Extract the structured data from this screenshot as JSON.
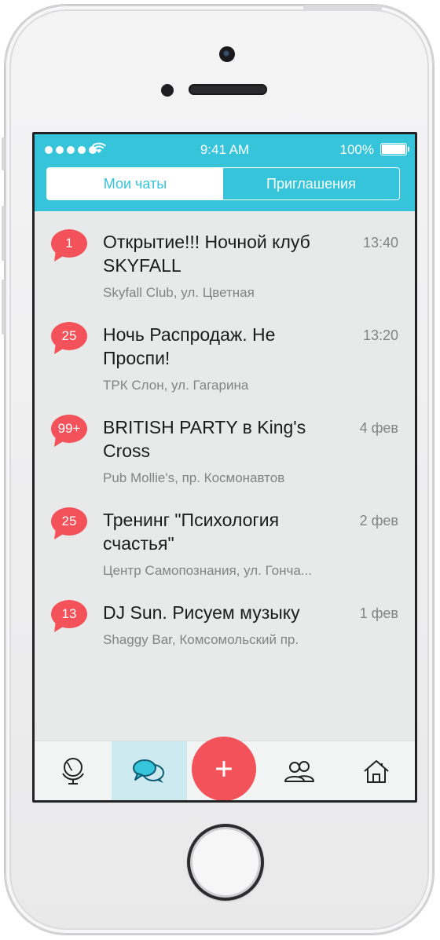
{
  "status_bar": {
    "time": "9:41 AM",
    "battery": "100%"
  },
  "tabs": {
    "active": "Мои чаты",
    "inactive": "Приглашения"
  },
  "chats": [
    {
      "badge": "1",
      "title": "Открытие!!! Ночной клуб SKYFALL",
      "place": "Skyfall Club, ул. Цветная",
      "time": "13:40"
    },
    {
      "badge": "25",
      "title": "Ночь Распродаж. Не Проспи!",
      "place": "ТРК Слон, ул. Гагарина",
      "time": "13:20"
    },
    {
      "badge": "99+",
      "title": "BRITISH PARTY в King's Cross",
      "place": "Pub Mollie's, пр. Космонавтов",
      "time": "4 фев"
    },
    {
      "badge": "25",
      "title": "Тренинг \"Психология счастья\"",
      "place": "Центр Самопознания, ул. Гонча...",
      "time": "2 фев"
    },
    {
      "badge": "13",
      "title": "DJ Sun. Рисуем музыку",
      "place": "Shaggy Bar, Комсомольский пр.",
      "time": "1 фев"
    }
  ],
  "colors": {
    "accent": "#35c4da",
    "badge": "#f4525a",
    "active_tab_bg": "#cdeaf0"
  },
  "tabbar_icons": [
    "globe-icon",
    "chat-bubbles-icon",
    "plus-icon",
    "people-icon",
    "home-icon"
  ],
  "fab": {
    "label": "+"
  }
}
